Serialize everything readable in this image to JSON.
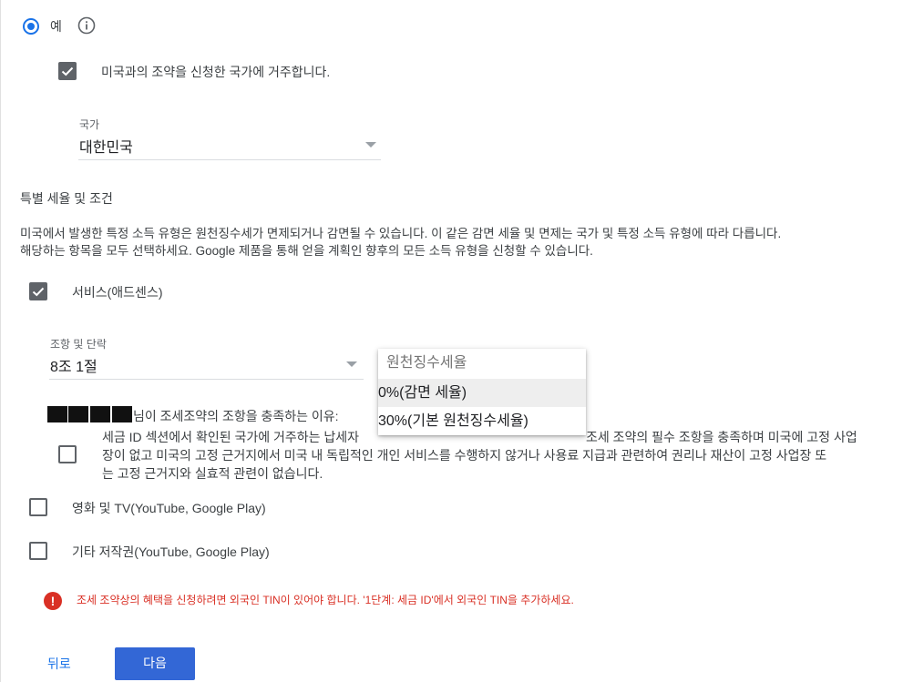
{
  "resident": {
    "yes_label": "예",
    "treaty_country_checkbox": "미국과의 조약을 신청한 국가에 거주합니다."
  },
  "country": {
    "label": "국가",
    "value": "대한민국"
  },
  "special": {
    "heading": "특별 세율 및 조건",
    "description_line1": "미국에서 발생한 특정 소득 유형은 원천징수세가 면제되거나 감면될 수 있습니다. 이 같은 감면 세율 및 면제는 국가 및 특정 소득 유형에 따라 다릅니다.",
    "description_line2": "해당하는 항목을 모두 선택하세요. Google 제품을 통해 얻을 계획인 향후의 모든 소득 유형을 신청할 수 있습니다."
  },
  "services": {
    "label": "서비스(애드센스)",
    "article_label": "조항 및 단락",
    "article_value": "8조 1절",
    "withholding_placeholder": "원천징수세율",
    "options": [
      "0%(감면 세율)",
      "30%(기본 원천징수세율)"
    ],
    "reason_suffix": "님이 조세조약의 조항을 충족하는 이유:",
    "reason_line1": "세금 ID 섹션에서 확인된 국가에 거주하는 납세자",
    "reason_line1_tail": "조세 조약의 필수 조항을 충족하며 미국에 고정 사업",
    "reason_line2": "장이 없고 미국의 고정 근거지에서 미국 내 독립적인 개인 서비스를 수행하지 않거나 사용료 지급과 관련하여 권리나 재산이 고정 사업장 또",
    "reason_line3": "는 고정 근거지와 실효적 관련이 없습니다."
  },
  "movies": {
    "label": "영화 및 TV(YouTube, Google Play)"
  },
  "other": {
    "label": "기타 저작권(YouTube, Google Play)"
  },
  "error": {
    "message": "조세 조약상의 혜택을 신청하려면 외국인 TIN이 있어야 합니다. '1단계: 세금 ID'에서 외국인 TIN을 추가하세요."
  },
  "nav": {
    "back": "뒤로",
    "next": "다음"
  },
  "colors": {
    "accent": "#1a73e8",
    "primary_button": "#3367d6",
    "error": "#d93025"
  }
}
